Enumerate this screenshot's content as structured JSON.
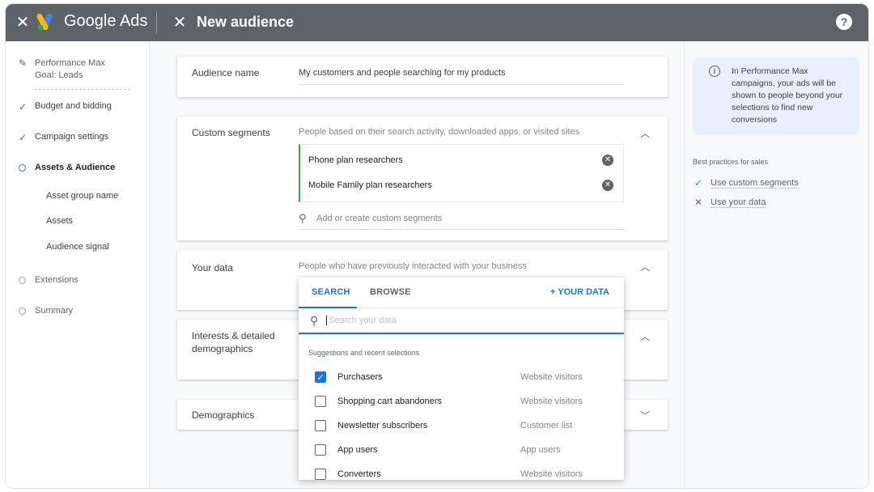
{
  "topbar": {
    "brand": "Google Ads",
    "title": "New audience",
    "help_glyph": "?",
    "close_glyph": "✕"
  },
  "left_nav": {
    "campaign": "Performance Max",
    "goal": "Goal: Leads",
    "items": [
      {
        "label": "Budget and bidding",
        "state": "done"
      },
      {
        "label": "Campaign settings",
        "state": "done"
      },
      {
        "label": "Assets & Audience",
        "state": "current"
      },
      {
        "label": "Extensions",
        "state": "todo"
      },
      {
        "label": "Summary",
        "state": "todo"
      }
    ],
    "subitems": [
      "Asset group name",
      "Assets",
      "Audience signal"
    ]
  },
  "audience_name": {
    "label": "Audience name",
    "value": "My customers and people searching for my products"
  },
  "custom_segments": {
    "label": "Custom segments",
    "description": "People based on their search activity, downloaded apps, or visited sites",
    "segments": [
      "Phone plan researchers",
      "Mobile Family plan researchers"
    ],
    "search_placeholder": "Add or create custom segments"
  },
  "your_data": {
    "label": "Your data",
    "description": "People who have previously interacted with your business"
  },
  "interests": {
    "label_line1": "Interests & detailed",
    "label_line2": "demographics"
  },
  "demographics": {
    "label": "Demographics"
  },
  "dropdown": {
    "tabs": [
      "SEARCH",
      "BROWSE"
    ],
    "add_link": "+ YOUR DATA",
    "search_placeholder": "Search your data",
    "caption": "Suggestions and recent selections",
    "rows": [
      {
        "label": "Purchasers",
        "source": "Website visitors",
        "checked": true
      },
      {
        "label": "Shopping cart abandoners",
        "source": "Website visitors",
        "checked": false
      },
      {
        "label": "Newsletter subscribers",
        "source": "Customer list",
        "checked": false
      },
      {
        "label": "App users",
        "source": "App users",
        "checked": false
      },
      {
        "label": "Converters",
        "source": "Website visitors",
        "checked": false
      }
    ]
  },
  "right_panel": {
    "info_text": "In Performance Max campaigns, your ads will be shown to people beyond your selections to find new conversions",
    "best_practices_title": "Best practices for sales",
    "best_practices": [
      {
        "label": "Use custom segments",
        "status": "met"
      },
      {
        "label": "Use your data",
        "status": "unmet"
      }
    ]
  },
  "colors": {
    "topbar": "#5f6368",
    "accent": "#1a73e8",
    "success": "#34a853",
    "info_bg": "#e8f0fe"
  }
}
